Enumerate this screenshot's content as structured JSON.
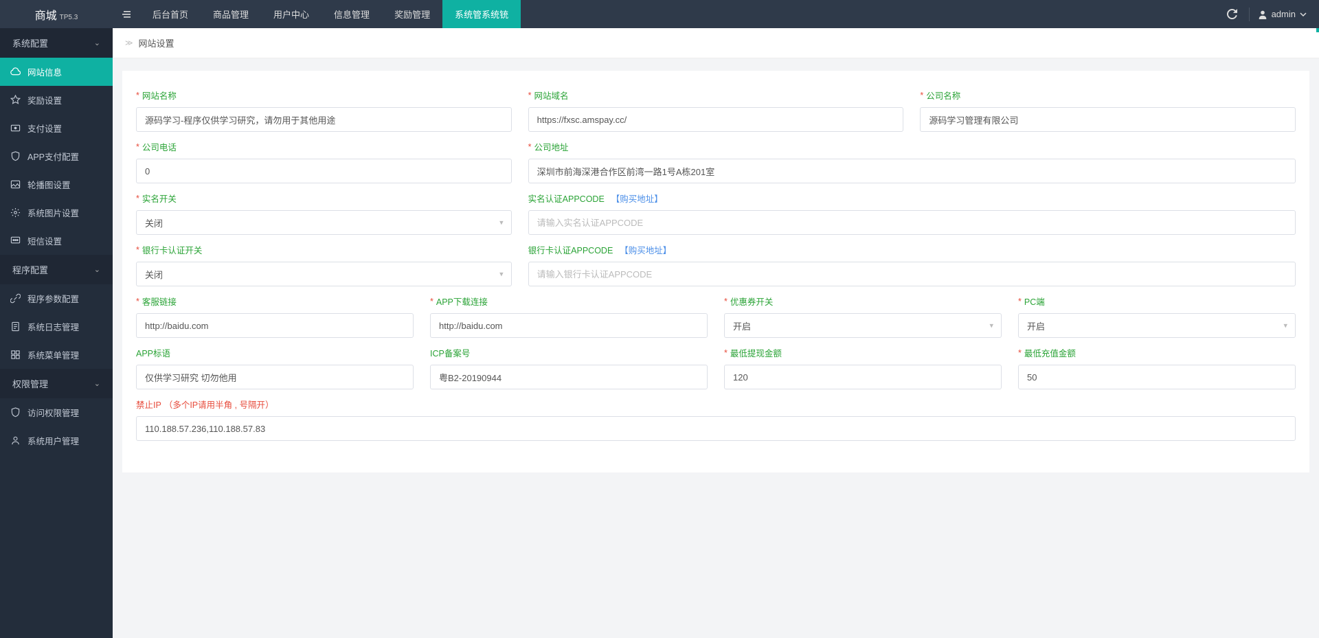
{
  "brand": {
    "name": "商城",
    "version": "TP5.3"
  },
  "topnav": {
    "items": [
      "后台首页",
      "商品管理",
      "用户中心",
      "信息管理",
      "奖励管理",
      "系统管系统铳"
    ],
    "active_index": 5
  },
  "user": {
    "name": "admin"
  },
  "sidebar": {
    "groups": [
      {
        "title": "系统配置",
        "items": [
          {
            "label": "网站信息",
            "icon": "cloud",
            "active": true
          },
          {
            "label": "奖励设置",
            "icon": "star"
          },
          {
            "label": "支付设置",
            "icon": "card"
          },
          {
            "label": "APP支付配置",
            "icon": "shield"
          },
          {
            "label": "轮播图设置",
            "icon": "image"
          },
          {
            "label": "系统图片设置",
            "icon": "gear"
          },
          {
            "label": "短信设置",
            "icon": "sms"
          }
        ]
      },
      {
        "title": "程序配置",
        "items": [
          {
            "label": "程序参数配置",
            "icon": "link"
          },
          {
            "label": "系统日志管理",
            "icon": "doc"
          },
          {
            "label": "系统菜单管理",
            "icon": "menu"
          }
        ]
      },
      {
        "title": "权限管理",
        "items": [
          {
            "label": "访问权限管理",
            "icon": "shield"
          },
          {
            "label": "系统用户管理",
            "icon": "user"
          }
        ]
      }
    ]
  },
  "breadcrumb": {
    "title": "网站设置"
  },
  "form": {
    "site_name": {
      "label": "网站名称",
      "value": "源码学习-程序仅供学习研究，请勿用于其他用途",
      "required": true
    },
    "site_domain": {
      "label": "网站域名",
      "value": "https://fxsc.amspay.cc/",
      "required": true
    },
    "company_name": {
      "label": "公司名称",
      "value": "源码学习管理有限公司",
      "required": true
    },
    "company_tel": {
      "label": "公司电话",
      "value": "0",
      "required": true
    },
    "company_addr": {
      "label": "公司地址",
      "value": "深圳市前海深港合作区前湾一路1号A栋201室",
      "required": true
    },
    "realname_switch": {
      "label": "实名开关",
      "value": "关闭",
      "required": true
    },
    "realname_appcode": {
      "label": "实名认证APPCODE",
      "placeholder": "请输入实名认证APPCODE",
      "link_text": "【购买地址】"
    },
    "bankcard_switch": {
      "label": "银行卡认证开关",
      "value": "关闭",
      "required": true
    },
    "bankcard_appcode": {
      "label": "银行卡认证APPCODE",
      "placeholder": "请输入银行卡认证APPCODE",
      "link_text": "【购买地址】"
    },
    "cs_link": {
      "label": "客服链接",
      "value": "http://baidu.com",
      "required": true
    },
    "app_dl_link": {
      "label": "APP下载连接",
      "value": "http://baidu.com",
      "required": true
    },
    "coupon_switch": {
      "label": "优惠券开关",
      "value": "开启",
      "required": true
    },
    "pc_switch": {
      "label": "PC端",
      "value": "开启",
      "required": true
    },
    "app_slogan": {
      "label": "APP标语",
      "value": "仅供学习研究 切勿他用"
    },
    "icp": {
      "label": "ICP备案号",
      "value": "粤B2-20190944"
    },
    "min_withdraw": {
      "label": "最低提现金额",
      "value": "120",
      "required": true
    },
    "min_topup": {
      "label": "最低充值金额",
      "value": "50",
      "required": true
    },
    "ban_ip": {
      "label": "禁止IP",
      "hint": "（多个IP请用半角 , 号隔开）",
      "value": "110.188.57.236,110.188.57.83"
    }
  }
}
